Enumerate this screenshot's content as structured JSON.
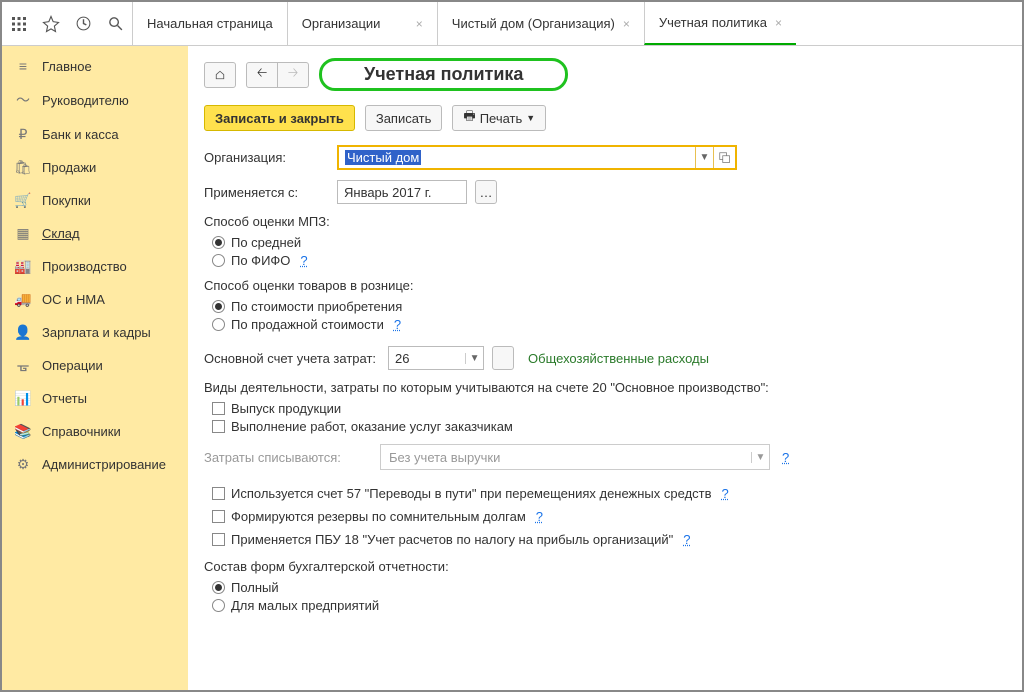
{
  "tabs": [
    {
      "label": "Начальная страница",
      "closable": false
    },
    {
      "label": "Организации",
      "closable": true
    },
    {
      "label": "Чистый дом (Организация)",
      "closable": true
    },
    {
      "label": "Учетная политика",
      "closable": true,
      "active": true
    }
  ],
  "sidebar": [
    {
      "icon": "≡",
      "label": "Главное"
    },
    {
      "icon": "〜",
      "label": "Руководителю"
    },
    {
      "icon": "₽",
      "label": "Банк и касса"
    },
    {
      "icon": "🛍",
      "label": "Продажи"
    },
    {
      "icon": "🛒",
      "label": "Покупки"
    },
    {
      "icon": "▦",
      "label": "Склад",
      "active": true
    },
    {
      "icon": "🏭",
      "label": "Производство"
    },
    {
      "icon": "🚚",
      "label": "ОС и НМА"
    },
    {
      "icon": "👤",
      "label": "Зарплата и кадры"
    },
    {
      "icon": "ᚗ",
      "label": "Операции"
    },
    {
      "icon": "📊",
      "label": "Отчеты"
    },
    {
      "icon": "📚",
      "label": "Справочники"
    },
    {
      "icon": "⚙",
      "label": "Администрирование"
    }
  ],
  "header": {
    "title": "Учетная политика"
  },
  "actions": {
    "save_close": "Записать и закрыть",
    "save": "Записать",
    "print": "Печать"
  },
  "form": {
    "org_label": "Организация:",
    "org_value": "Чистый дом",
    "applies_from_label": "Применяется с:",
    "applies_from_value": "Январь 2017 г.",
    "mpz_label": "Способ оценки МПЗ:",
    "mpz_options": [
      "По средней",
      "По ФИФО"
    ],
    "retail_label": "Способ оценки товаров в рознице:",
    "retail_options": [
      "По стоимости приобретения",
      "По продажной стоимости"
    ],
    "cost_account_label": "Основной счет учета затрат:",
    "cost_account_value": "26",
    "cost_account_hint": "Общехозяйственные расходы",
    "activities_label": "Виды деятельности, затраты по которым учитываются на счете 20 \"Основное производство\":",
    "activities_checks": [
      "Выпуск продукции",
      "Выполнение работ, оказание услуг заказчикам"
    ],
    "writeoff_label": "Затраты списываются:",
    "writeoff_value": "Без учета выручки",
    "check_57": "Используется счет 57 \"Переводы в пути\" при перемещениях денежных средств",
    "check_reserves": "Формируются резервы по сомнительным долгам",
    "check_pbu18": "Применяется ПБУ 18 \"Учет расчетов по налогу на прибыль организаций\"",
    "reports_label": "Состав форм бухгалтерской отчетности:",
    "reports_options": [
      "Полный",
      "Для малых предприятий"
    ]
  }
}
